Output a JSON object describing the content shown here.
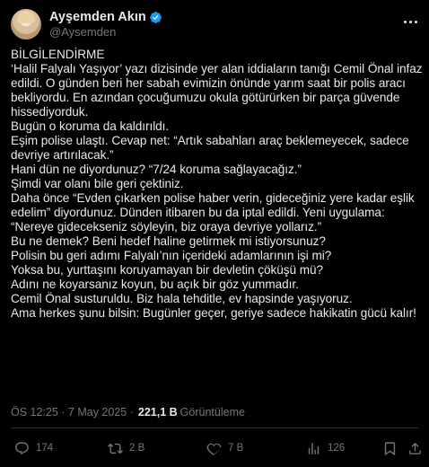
{
  "author": {
    "display_name": "Ayşemden Akın",
    "handle": "@Aysemden",
    "verified_color": "#1d9bf0"
  },
  "tweet": {
    "lines": [
      "BİLGİLENDİRME",
      "‘Halil Falyalı Yaşıyor’ yazı dizisinde yer alan iddiaların tanığı Cemil Önal infaz edildi. O günden beri her sabah evimizin önünde yarım saat bir polis aracı bekliyordu. En azından çocuğumuzu okula götürürken bir parça güvende hissediyorduk.",
      "Bugün o koruma da kaldırıldı.",
      "Eşim polise ulaştı. Cevap net: “Artık sabahları araç beklemeyecek, sadece devriye artırılacak.”",
      "Hani dün ne diyordunuz? “7/24 koruma sağlayacağız.”",
      "Şimdi var olanı bile geri çektiniz.",
      "Daha önce “Evden çıkarken polise haber verin, gideceğiniz yere kadar eşlik edelim” diyordunuz. Dünden itibaren bu da iptal edildi. Yeni uygulama: “Nereye gidecekseniz söyleyin, biz oraya devriye yollarız.”",
      "Bu ne demek? Beni hedef haline getirmek mi istiyorsunuz?",
      "Polisin bu geri adımı Falyalı’nın içerideki adamlarının işi mi?",
      "Yoksa bu, yurttaşını koruyamayan bir devletin çöküşü mü?",
      "Adını ne koyarsanız koyun, bu açık bir göz yummadır.",
      "Cemil Önal susturuldu. Biz hala tehditle, ev hapsinde yaşıyoruz.",
      "Ama herkes şunu bilsin: Bugünler geçer, geriye sadece hakikatin gücü kalır!"
    ],
    "timestamp": "ÖS 12:25 · 7 May 2025 ·",
    "views_count": "221,1 B",
    "views_label": "Görüntüleme"
  },
  "actions": {
    "reply_count": "174",
    "retweet_count": "2 B",
    "like_count": "7 B",
    "views_count": "126"
  },
  "icons": {
    "reply": "reply-icon",
    "retweet": "retweet-icon",
    "like": "heart-icon",
    "views": "bar-chart-icon",
    "bookmark": "bookmark-icon",
    "share": "share-icon",
    "more": "more-icon"
  },
  "colors": {
    "background": "#000000",
    "text": "#e7e9ea",
    "secondary": "#71767b",
    "divider": "#2f3336"
  }
}
